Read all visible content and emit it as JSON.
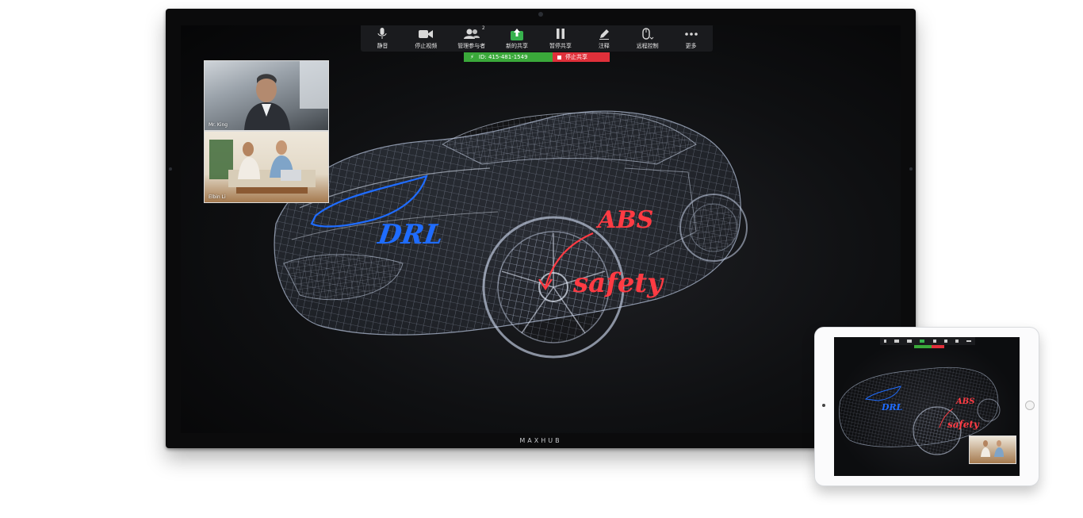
{
  "display": {
    "brand": "MAXHUB"
  },
  "toolbar": {
    "items": [
      {
        "id": "mute",
        "label": "静音",
        "icon": "microphone-icon"
      },
      {
        "id": "stop-video",
        "label": "停止视频",
        "icon": "video-camera-icon"
      },
      {
        "id": "participants",
        "label": "管理参与者",
        "icon": "participants-icon",
        "badge": "2"
      },
      {
        "id": "new-share",
        "label": "新的共享",
        "icon": "share-screen-icon"
      },
      {
        "id": "pause-share",
        "label": "暂停共享",
        "icon": "pause-icon"
      },
      {
        "id": "annotate",
        "label": "注释",
        "icon": "pencil-icon"
      },
      {
        "id": "remote-control",
        "label": "远程控制",
        "icon": "mouse-icon"
      },
      {
        "id": "more",
        "label": "更多",
        "icon": "more-dots-icon"
      }
    ]
  },
  "meeting": {
    "id_text": "ID: 415-481-1549",
    "stop_share": "停止共享"
  },
  "participants": [
    {
      "name": "Mr. King"
    },
    {
      "name": "Elbin Li"
    }
  ],
  "annotations": {
    "drl": "DRL",
    "abs": "ABS",
    "safety": "safety"
  },
  "colors": {
    "accent_green": "#3aa93a",
    "stop_red": "#e0303a",
    "annotation_blue": "#1f6cff",
    "annotation_red": "#ff3b43"
  }
}
